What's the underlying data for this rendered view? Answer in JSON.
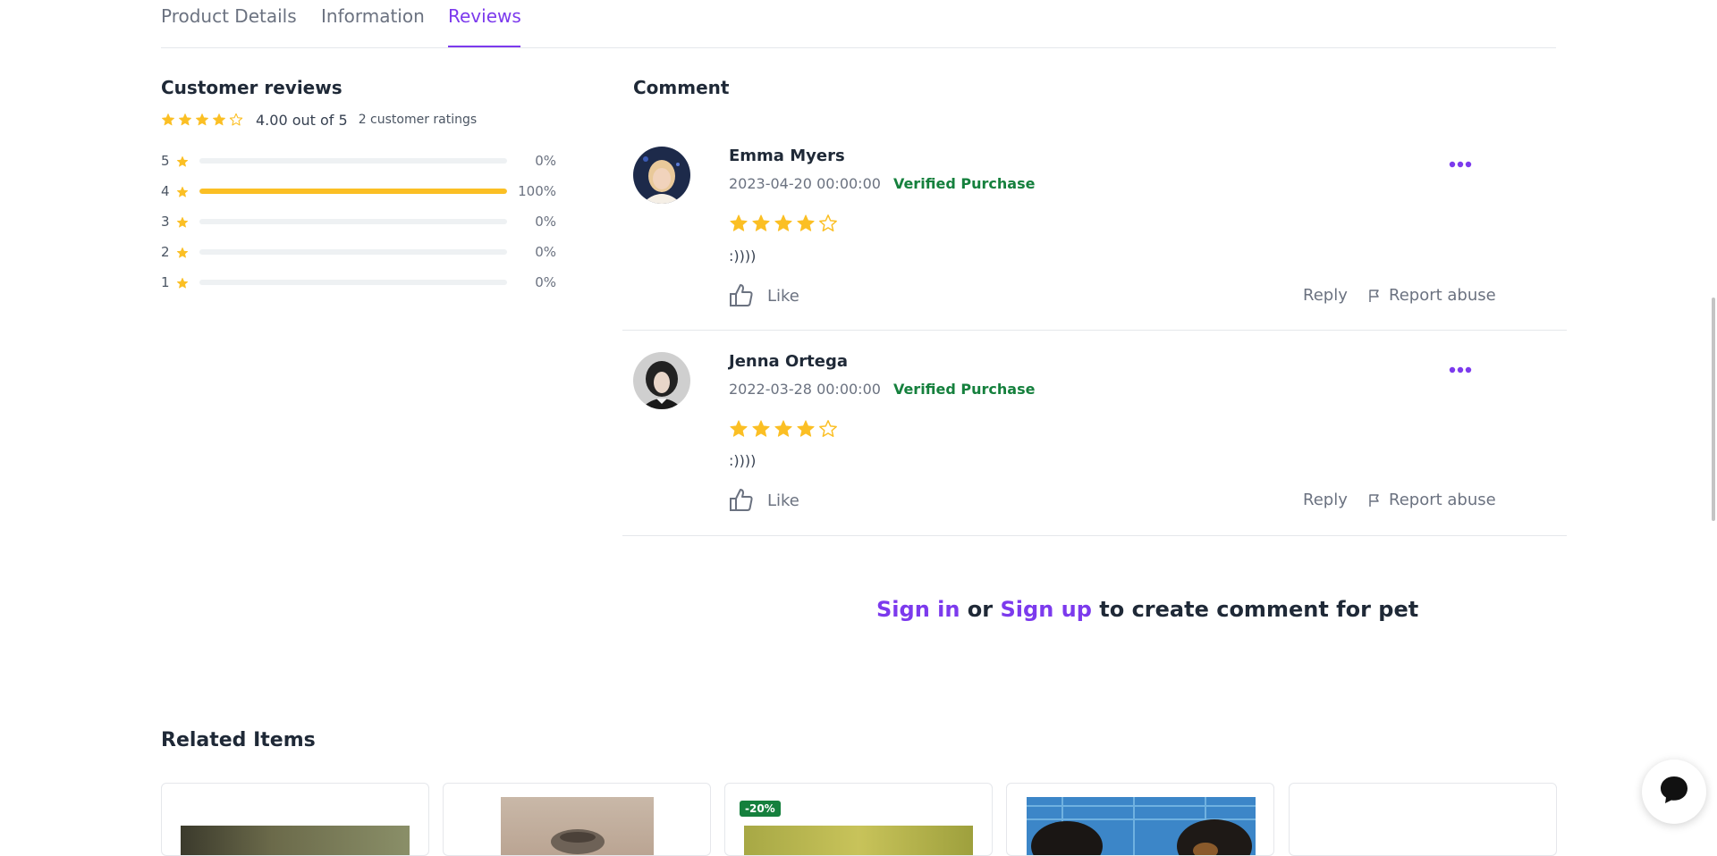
{
  "tabs": [
    {
      "label": "Product Details",
      "active": false
    },
    {
      "label": "Information",
      "active": false
    },
    {
      "label": "Reviews",
      "active": true
    }
  ],
  "customer_reviews": {
    "title": "Customer reviews",
    "average_rating": 4,
    "average_text": "4.00 out of 5",
    "ratings_count_text": "2 customer ratings",
    "breakdown": [
      {
        "stars": "5",
        "percent_text": "0%",
        "fraction": 0
      },
      {
        "stars": "4",
        "percent_text": "100%",
        "fraction": 1
      },
      {
        "stars": "3",
        "percent_text": "0%",
        "fraction": 0
      },
      {
        "stars": "2",
        "percent_text": "0%",
        "fraction": 0
      },
      {
        "stars": "1",
        "percent_text": "0%",
        "fraction": 0
      }
    ]
  },
  "comments": {
    "title": "Comment",
    "items": [
      {
        "name": "Emma Myers",
        "date": "2023-04-20 00:00:00",
        "verified": "Verified Purchase",
        "rating": 4,
        "text": ":))))",
        "like_label": "Like",
        "reply_label": "Reply",
        "report_label": "Report abuse"
      },
      {
        "name": "Jenna Ortega",
        "date": "2022-03-28 00:00:00",
        "verified": "Verified Purchase",
        "rating": 4,
        "text": ":))))",
        "like_label": "Like",
        "reply_label": "Reply",
        "report_label": "Report abuse"
      }
    ]
  },
  "signin_prompt": {
    "signin": "Sign in",
    "or": " or ",
    "signup": "Sign up",
    "rest": " to create comment for pet"
  },
  "related": {
    "title": "Related Items",
    "discount_badge": "-20%"
  },
  "colors": {
    "accent": "#7c3aed",
    "star": "#fbbf24",
    "verified": "#15803d"
  },
  "icons": [
    "star-icon",
    "thumbs-up-icon",
    "flag-icon",
    "more-dots-icon",
    "chat-icon"
  ]
}
